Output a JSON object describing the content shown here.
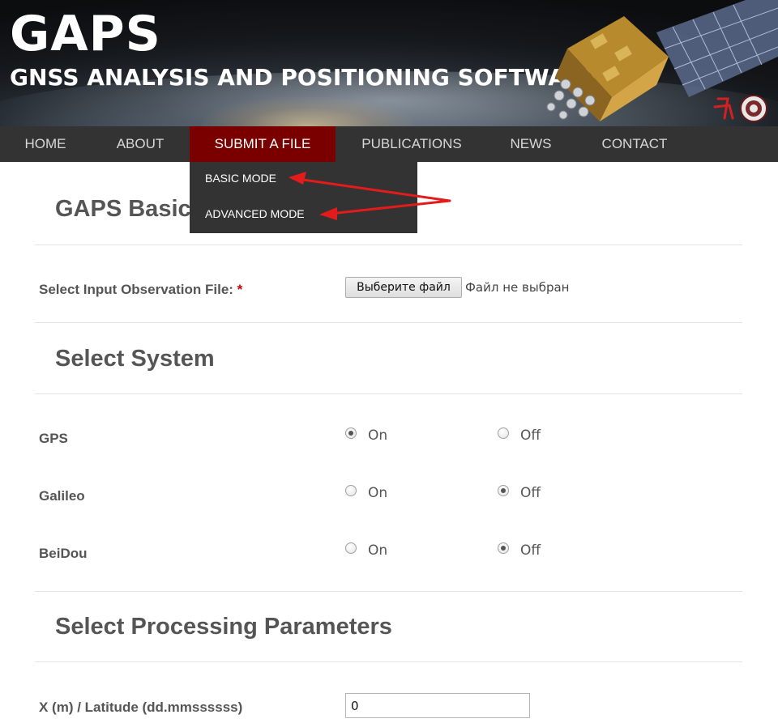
{
  "header": {
    "brand_title": "GAPS",
    "brand_subtitle": "GNSS ANALYSIS AND POSITIONING SOFTWARE"
  },
  "nav": {
    "items": [
      {
        "label": "HOME",
        "active": false
      },
      {
        "label": "ABOUT",
        "active": false
      },
      {
        "label": "SUBMIT A FILE",
        "active": true
      },
      {
        "label": "PUBLICATIONS",
        "active": false
      },
      {
        "label": "NEWS",
        "active": false
      },
      {
        "label": "CONTACT",
        "active": false
      }
    ],
    "dropdown": {
      "basic_mode": "BASIC MODE",
      "advanced_mode": "ADVANCED MODE"
    },
    "accent_color": "#7a0000",
    "bar_color": "#333333"
  },
  "main": {
    "page_heading": "GAPS Basic",
    "file_field": {
      "label": "Select Input Observation File:",
      "required_mark": "*",
      "button_label": "Выберите файл",
      "status": "Файл не выбран"
    },
    "system_section": {
      "title": "Select System",
      "on_label": "On",
      "off_label": "Off",
      "systems": [
        {
          "name": "GPS",
          "selected": "On"
        },
        {
          "name": "Galileo",
          "selected": "Off"
        },
        {
          "name": "BeiDou",
          "selected": "Off"
        }
      ]
    },
    "processing_section": {
      "title": "Select Processing Parameters",
      "x_latitude_label": "X (m) / Latitude (dd.mmssssss)",
      "x_latitude_value": "0"
    }
  }
}
